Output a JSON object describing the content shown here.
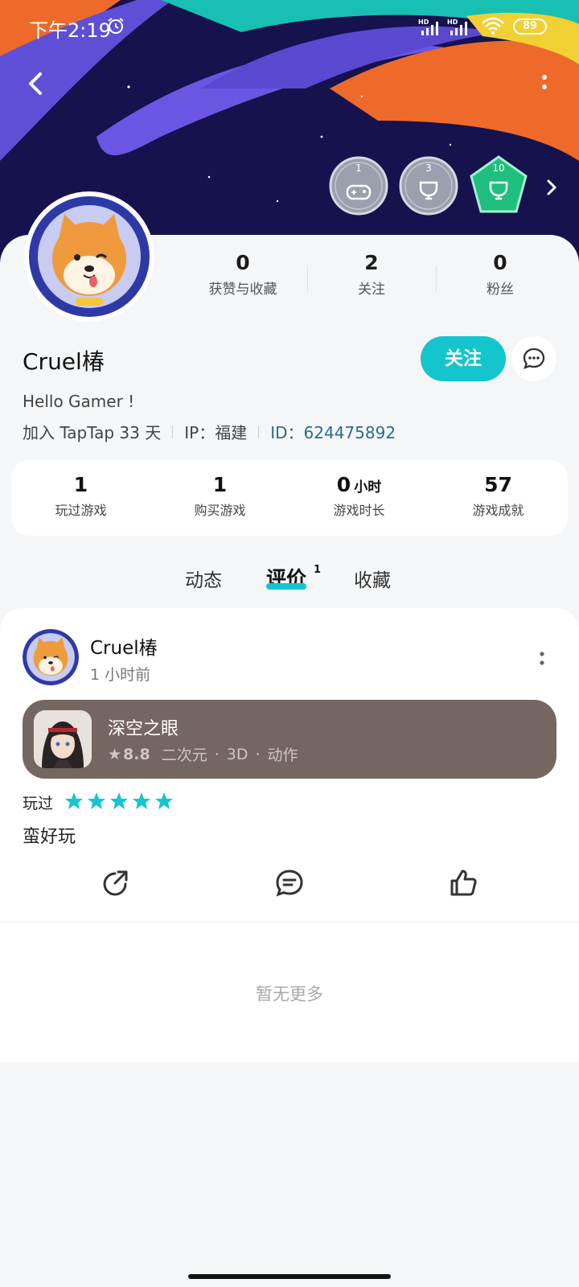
{
  "status_bar": {
    "time": "下午2:19",
    "battery": "89",
    "signal_label": "HD"
  },
  "header": {
    "badges": [
      {
        "number": "1",
        "icon": "gamepad-icon",
        "color": "#9aa0ae"
      },
      {
        "number": "3",
        "icon": "trophy-icon",
        "color": "#9aa0ae"
      },
      {
        "number": "10",
        "icon": "trophy-icon",
        "color": "#1fbf7e"
      }
    ]
  },
  "profile": {
    "stats": [
      {
        "value": "0",
        "label": "获赞与收藏"
      },
      {
        "value": "2",
        "label": "关注"
      },
      {
        "value": "0",
        "label": "粉丝"
      }
    ],
    "username": "Cruel椿",
    "follow_label": "关注",
    "bio": "Hello Gamer !",
    "joined": "加入 TapTap 33 天",
    "ip": "IP：福建",
    "id": "ID：624475892"
  },
  "game_stats": [
    {
      "value": "1",
      "unit": "",
      "label": "玩过游戏"
    },
    {
      "value": "1",
      "unit": "",
      "label": "购买游戏"
    },
    {
      "value": "0",
      "unit": "小时",
      "label": "游戏时长"
    },
    {
      "value": "57",
      "unit": "",
      "label": "游戏成就"
    }
  ],
  "tabs": {
    "items": [
      "动态",
      "评价",
      "收藏"
    ],
    "active": "评价",
    "review_count": "1"
  },
  "post": {
    "user": "Cruel椿",
    "time": "1 小时前",
    "game": {
      "title": "深空之眼",
      "score": "8.8",
      "tags": [
        "二次元",
        "3D",
        "动作"
      ]
    },
    "played_label": "玩过",
    "rating": 5,
    "comment": "蛮好玩"
  },
  "footer": {
    "no_more": "暂无更多"
  },
  "colors": {
    "accent": "#15c5ce",
    "game_card": "#756660",
    "id_link": "#2c6b8a"
  }
}
